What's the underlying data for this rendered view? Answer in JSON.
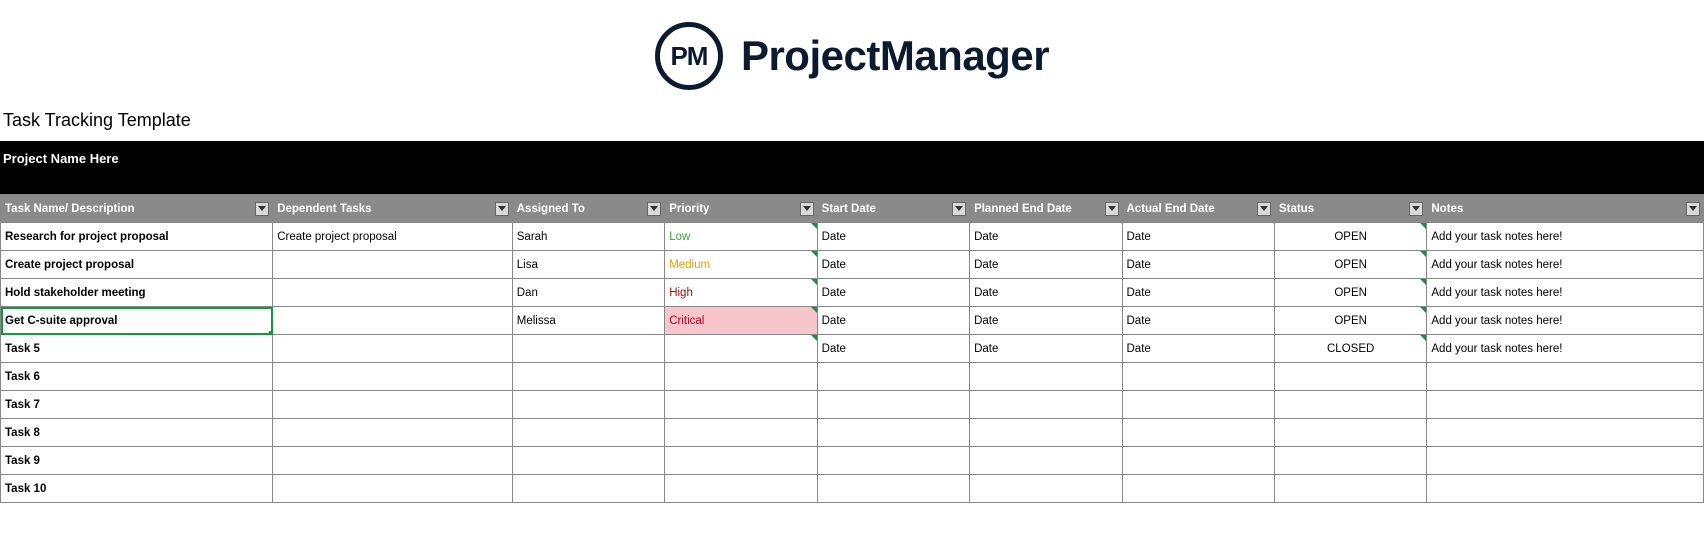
{
  "brand": {
    "initials": "PM",
    "name": "ProjectManager"
  },
  "template_title": "Task Tracking Template",
  "project_name": "Project Name Here",
  "columns": {
    "task": "Task Name/ Description",
    "dep": "Dependent Tasks",
    "asg": "Assigned To",
    "pri": "Priority",
    "sd": "Start Date",
    "ped": "Planned End Date",
    "aed": "Actual End Date",
    "stat": "Status",
    "notes": "Notes"
  },
  "priority_styles": {
    "Low": "prio-low",
    "Medium": "prio-medium",
    "High": "prio-high",
    "Critical": "prio-critical"
  },
  "rows": [
    {
      "task": "Research for project proposal",
      "dep": "Create project proposal",
      "asg": "Sarah",
      "pri": "Low",
      "sd": "Date",
      "ped": "Date",
      "aed": "Date",
      "stat": "OPEN",
      "notes": "Add your task notes here!",
      "sel": false
    },
    {
      "task": "Create project proposal",
      "dep": "",
      "asg": "Lisa",
      "pri": "Medium",
      "sd": "Date",
      "ped": "Date",
      "aed": "Date",
      "stat": "OPEN",
      "notes": "Add your task notes here!",
      "sel": false
    },
    {
      "task": "Hold stakeholder meeting",
      "dep": "",
      "asg": "Dan",
      "pri": "High",
      "sd": "Date",
      "ped": "Date",
      "aed": "Date",
      "stat": "OPEN",
      "notes": "Add your task notes here!",
      "sel": false
    },
    {
      "task": "Get C-suite approval",
      "dep": "",
      "asg": "Melissa",
      "pri": "Critical",
      "sd": "Date",
      "ped": "Date",
      "aed": "Date",
      "stat": "OPEN",
      "notes": "Add your task notes here!",
      "sel": true
    },
    {
      "task": "Task 5",
      "dep": "",
      "asg": "",
      "pri": "",
      "sd": "Date",
      "ped": "Date",
      "aed": "Date",
      "stat": "CLOSED",
      "notes": "Add your task notes here!",
      "sel": false
    },
    {
      "task": "Task 6",
      "dep": "",
      "asg": "",
      "pri": "",
      "sd": "",
      "ped": "",
      "aed": "",
      "stat": "",
      "notes": "",
      "sel": false
    },
    {
      "task": "Task 7",
      "dep": "",
      "asg": "",
      "pri": "",
      "sd": "",
      "ped": "",
      "aed": "",
      "stat": "",
      "notes": "",
      "sel": false
    },
    {
      "task": "Task 8",
      "dep": "",
      "asg": "",
      "pri": "",
      "sd": "",
      "ped": "",
      "aed": "",
      "stat": "",
      "notes": "",
      "sel": false
    },
    {
      "task": "Task 9",
      "dep": "",
      "asg": "",
      "pri": "",
      "sd": "",
      "ped": "",
      "aed": "",
      "stat": "",
      "notes": "",
      "sel": false
    },
    {
      "task": "Task 10",
      "dep": "",
      "asg": "",
      "pri": "",
      "sd": "",
      "ped": "",
      "aed": "",
      "stat": "",
      "notes": "",
      "sel": false
    }
  ]
}
